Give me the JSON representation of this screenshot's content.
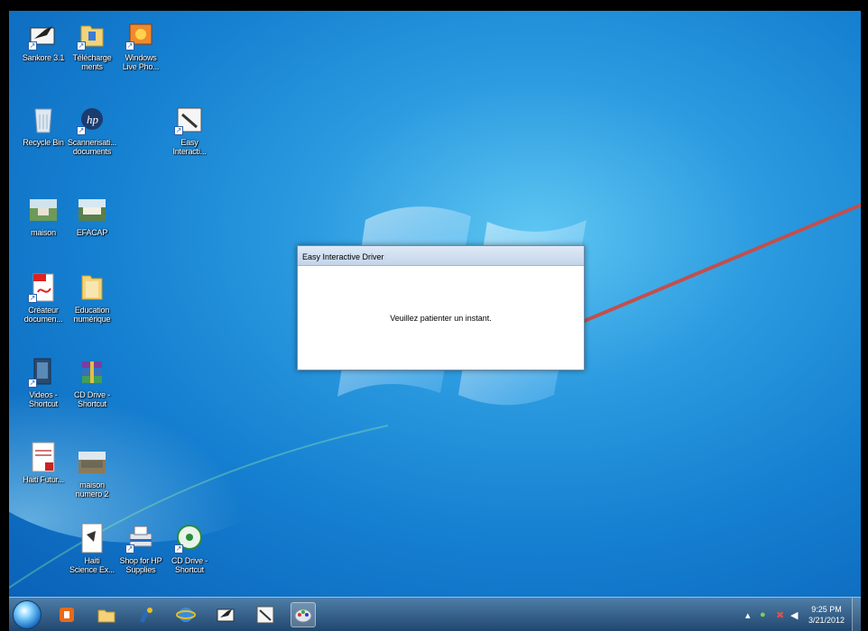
{
  "desktop": {
    "icons": [
      {
        "id": "sankore",
        "label": "Sankore 3.1",
        "label2": "",
        "icon": "sankore-icon"
      },
      {
        "id": "telechargements",
        "label": "Télécharge",
        "label2": "ments",
        "icon": "folder-icon"
      },
      {
        "id": "windows-live-photo",
        "label": "Windows",
        "label2": "Live Pho...",
        "icon": "photo-gallery-icon"
      },
      {
        "id": "recycle-bin",
        "label": "Recycle Bin",
        "label2": "",
        "icon": "recycle-bin-icon"
      },
      {
        "id": "scannerisation",
        "label": "Scannerisati...",
        "label2": "documents",
        "icon": "hp-icon"
      },
      {
        "id": "easy-interactive",
        "label": "Easy",
        "label2": "Interacti...",
        "icon": "easy-interactive-icon"
      },
      {
        "id": "maison",
        "label": "maison",
        "label2": "",
        "icon": "photo-icon"
      },
      {
        "id": "efacap",
        "label": "EFACAP",
        "label2": "",
        "icon": "photo-icon"
      },
      {
        "id": "createur-documents",
        "label": "Créateur",
        "label2": "documen...",
        "icon": "pdf-icon"
      },
      {
        "id": "education-numerique",
        "label": "Education",
        "label2": "numérique",
        "icon": "folder-icon"
      },
      {
        "id": "videos-shortcut",
        "label": "Videos -",
        "label2": "Shortcut",
        "icon": "video-icon"
      },
      {
        "id": "cd-drive-shortcut-1",
        "label": "CD Drive -",
        "label2": "Shortcut",
        "icon": "winrar-icon"
      },
      {
        "id": "haiti-futur",
        "label": "Haiti Futur...",
        "label2": "",
        "icon": "pdf-document-icon"
      },
      {
        "id": "maison-numero-2",
        "label": "maison",
        "label2": "numero 2",
        "icon": "photo-icon"
      },
      {
        "id": "haiti-science",
        "label": "Haiti",
        "label2": "Science Ex...",
        "icon": "document-icon"
      },
      {
        "id": "shop-hp-supplies",
        "label": "Shop for HP",
        "label2": "Supplies",
        "icon": "printer-icon"
      },
      {
        "id": "cd-drive-shortcut-2",
        "label": "CD Drive -",
        "label2": "Shortcut",
        "icon": "cd-drive-icon"
      }
    ]
  },
  "dialog": {
    "title": "Easy Interactive Driver",
    "message": "Veuillez patienter un instant."
  },
  "taskbar": {
    "pinned": [
      "office-icon",
      "explorer-icon",
      "paint-icon",
      "internet-explorer-icon",
      "sankore-icon",
      "easy-interactive-icon",
      "palette-icon"
    ],
    "tray": {
      "time": "9:25 PM",
      "date": "3/21/2012"
    }
  },
  "colors": {
    "annotation_arrow": "#c0504d",
    "desktop_blue": "#1a86d4"
  }
}
